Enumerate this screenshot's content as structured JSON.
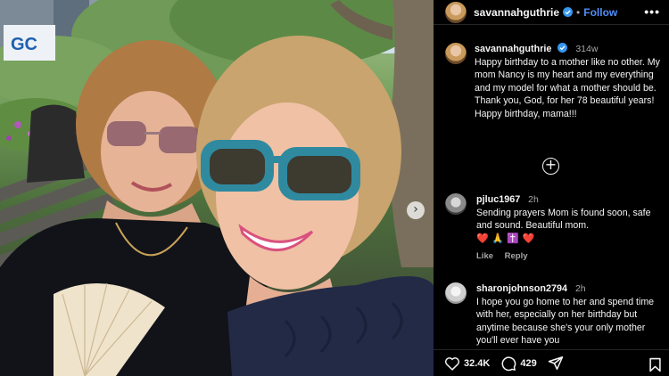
{
  "post": {
    "username": "savannahguthrie",
    "follow_label": "Follow",
    "more_label": "•••",
    "separator": "•"
  },
  "caption": {
    "username": "savannahguthrie",
    "time": "314w",
    "text": "Happy birthday to a mother like no other. My mom Nancy is my heart and my everything and my model for what a mother should be. Thank you, God, for her 78 beautiful years! Happy birthday, mama!!!"
  },
  "load_more_icon": "plus-circle-icon",
  "comments": [
    {
      "username": "pjluc1967",
      "time": "2h",
      "text": "Sending prayers Mom is found soon, safe and sound. Beautiful mom.",
      "emoji": "❤️ 🙏 ✝️ ❤️",
      "like_label": "Like",
      "reply_label": "Reply"
    },
    {
      "username": "sharonjohnson2794",
      "time": "2h",
      "text": "I hope you go home to her and spend time with her, especially on her birthday but anytime because she's your only mother you'll ever have you"
    }
  ],
  "actions": {
    "likes": "32.4K",
    "comments": "429"
  },
  "photo": {
    "sign_text": "GC"
  },
  "colors": {
    "follow": "#4f8ef7",
    "background": "#000000",
    "verified": "#3797f0"
  }
}
